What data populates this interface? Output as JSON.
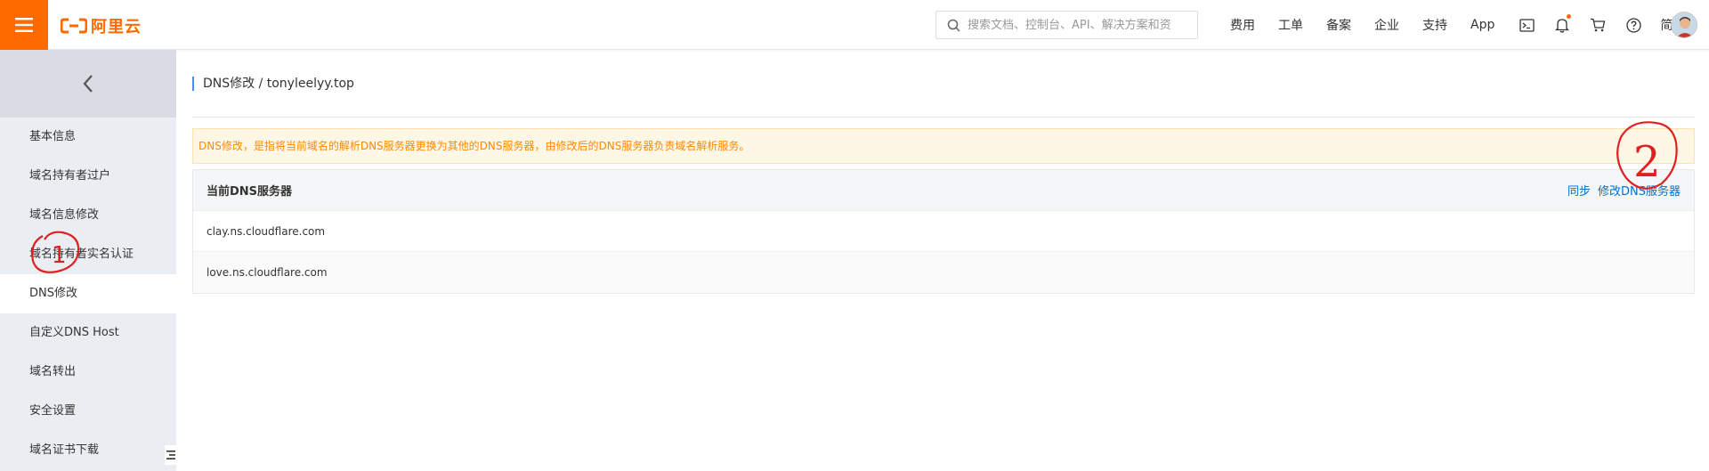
{
  "header": {
    "logo_text": "阿里云",
    "search_placeholder": "搜索文档、控制台、API、解决方案和资",
    "nav": [
      "费用",
      "工单",
      "备案",
      "企业",
      "支持",
      "App"
    ],
    "lang": "简体",
    "icons": [
      "terminal-icon",
      "bell-icon",
      "cart-icon",
      "help-icon"
    ],
    "accent_color": "#ff6a00"
  },
  "sidebar": {
    "items": [
      {
        "label": "基本信息"
      },
      {
        "label": "域名持有者过户"
      },
      {
        "label": "域名信息修改"
      },
      {
        "label": "域名持有者实名认证"
      },
      {
        "label": "DNS修改",
        "active": true
      },
      {
        "label": "自定义DNS Host"
      },
      {
        "label": "域名转出"
      },
      {
        "label": "安全设置"
      },
      {
        "label": "域名证书下载"
      }
    ]
  },
  "main": {
    "breadcrumb": "DNS修改 / tonyleelyy.top",
    "notice": "DNS修改，是指将当前域名的解析DNS服务器更换为其他的DNS服务器，由修改后的DNS服务器负责域名解析服务。",
    "table": {
      "title": "当前DNS服务器",
      "sync_label": "同步",
      "modify_label": "修改DNS服务器",
      "rows": [
        "clay.ns.cloudflare.com",
        "love.ns.cloudflare.com"
      ]
    }
  },
  "annotations": [
    "1",
    "2"
  ]
}
